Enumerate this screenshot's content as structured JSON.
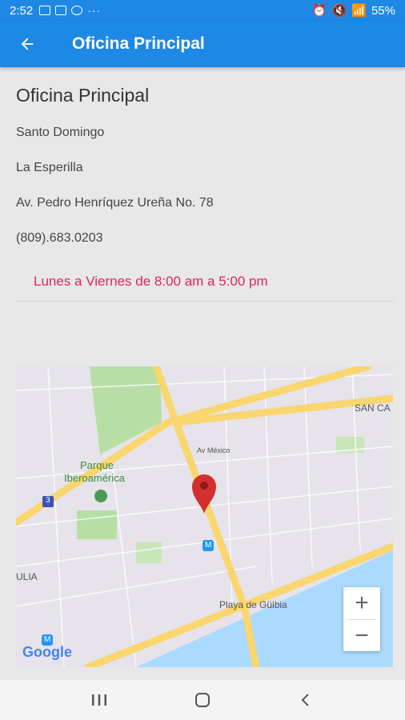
{
  "status_bar": {
    "time": "2:52",
    "battery": "55%"
  },
  "app_bar": {
    "title": "Oficina Principal"
  },
  "office": {
    "name": "Oficina Principal",
    "city": "Santo Domingo",
    "sector": "La Esperilla",
    "address": "Av. Pedro Henríquez Ureña No. 78",
    "phone": "(809).683.0203",
    "hours": "Lunes a Viernes de 8:00 am a 5:00 pm",
    "hours_color": "#e0245e"
  },
  "map": {
    "labels": {
      "park": "Parque",
      "park2": "Iberoamérica",
      "street": "Av México",
      "beach": "Playa de Güibia",
      "san_carlos": "SAN CA",
      "julia": "ULIA",
      "route": "3",
      "metro": "M",
      "google": "Google"
    },
    "zoom_in": "+",
    "zoom_out": "−"
  },
  "colors": {
    "primary": "#1e88e5",
    "background": "#e8e8e8",
    "marker": "#d32f2f",
    "water": "#aadaff",
    "park": "#b7dfa5",
    "road": "#f9d66e"
  }
}
